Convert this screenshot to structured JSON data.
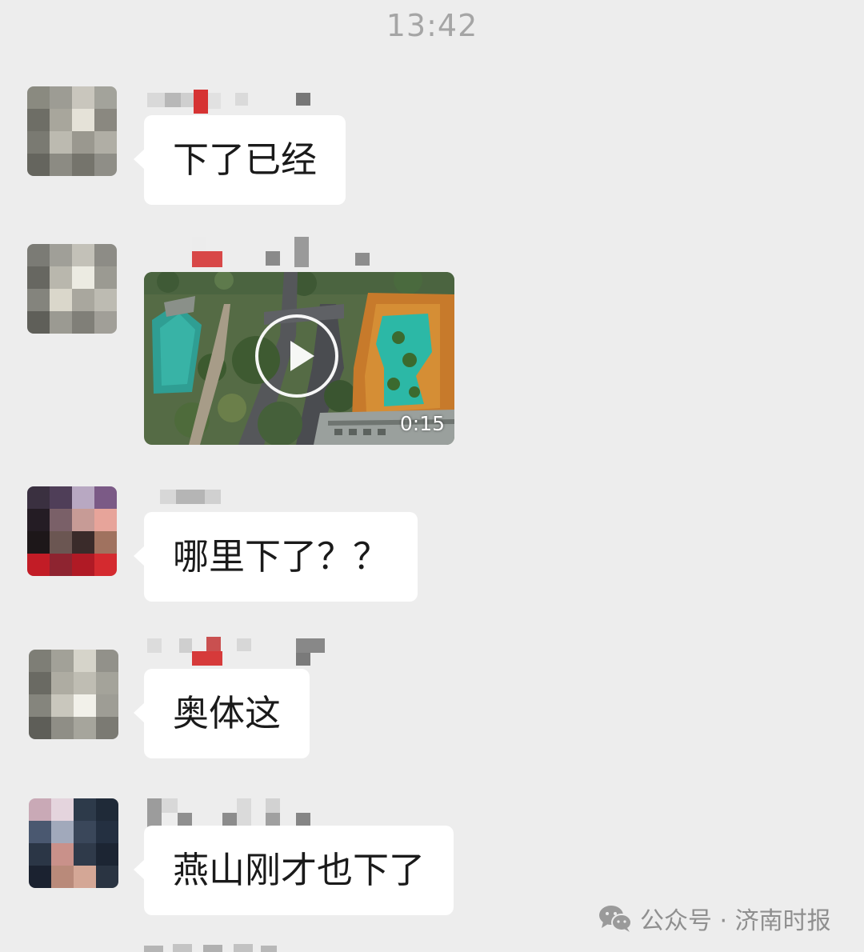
{
  "chat": {
    "timestamp": "13:42",
    "messages": [
      {
        "type": "text",
        "text": "下了已经"
      },
      {
        "type": "video",
        "duration": "0:15"
      },
      {
        "type": "text",
        "text": "哪里下了？？"
      },
      {
        "type": "text",
        "text": "奥体这"
      },
      {
        "type": "text",
        "text": "燕山刚才也下了"
      }
    ]
  },
  "watermark": {
    "icon": "wechat-icon",
    "text": "公众号 · 济南时报"
  }
}
